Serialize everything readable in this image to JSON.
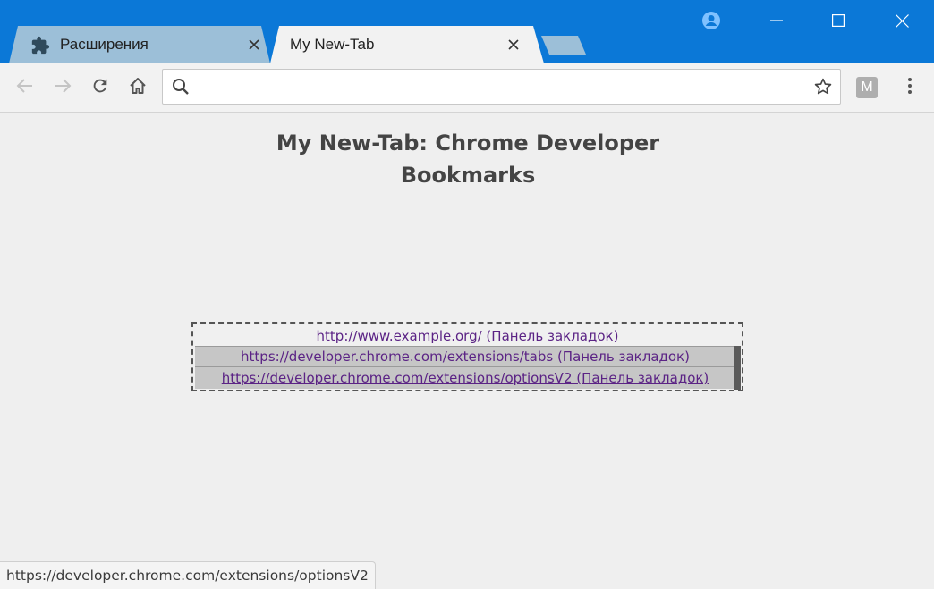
{
  "window": {
    "minimize_label": "Minimize",
    "maximize_label": "Maximize",
    "close_label": "Close",
    "accent_color": "#0b78d7"
  },
  "tabs": [
    {
      "title": "Расширения",
      "icon": "puzzle-icon",
      "active": false
    },
    {
      "title": "My New-Tab",
      "active": true
    }
  ],
  "toolbar": {
    "back_icon": "back-arrow-icon",
    "forward_icon": "forward-arrow-icon",
    "reload_icon": "reload-icon",
    "home_icon": "home-icon",
    "omnibox_value": "",
    "bookmark_star_icon": "star-icon",
    "extension_letter": "M",
    "menu_icon": "kebab-menu-icon"
  },
  "page": {
    "title": "My New-Tab: Chrome Developer Bookmarks",
    "bookmarks": [
      {
        "url": "http://www.example.org/",
        "label": "http://www.example.org/ (Панель закладок)"
      },
      {
        "url": "https://developer.chrome.com/extensions/tabs",
        "label": "https://developer.chrome.com/extensions/tabs (Панель закладок)"
      },
      {
        "url": "https://developer.chrome.com/extensions/optionsV2",
        "label": "https://developer.chrome.com/extensions/optionsV2 (Панель закладок)"
      }
    ],
    "link_color": "#5b2385"
  },
  "status_bar": {
    "text": "https://developer.chrome.com/extensions/optionsV2"
  }
}
